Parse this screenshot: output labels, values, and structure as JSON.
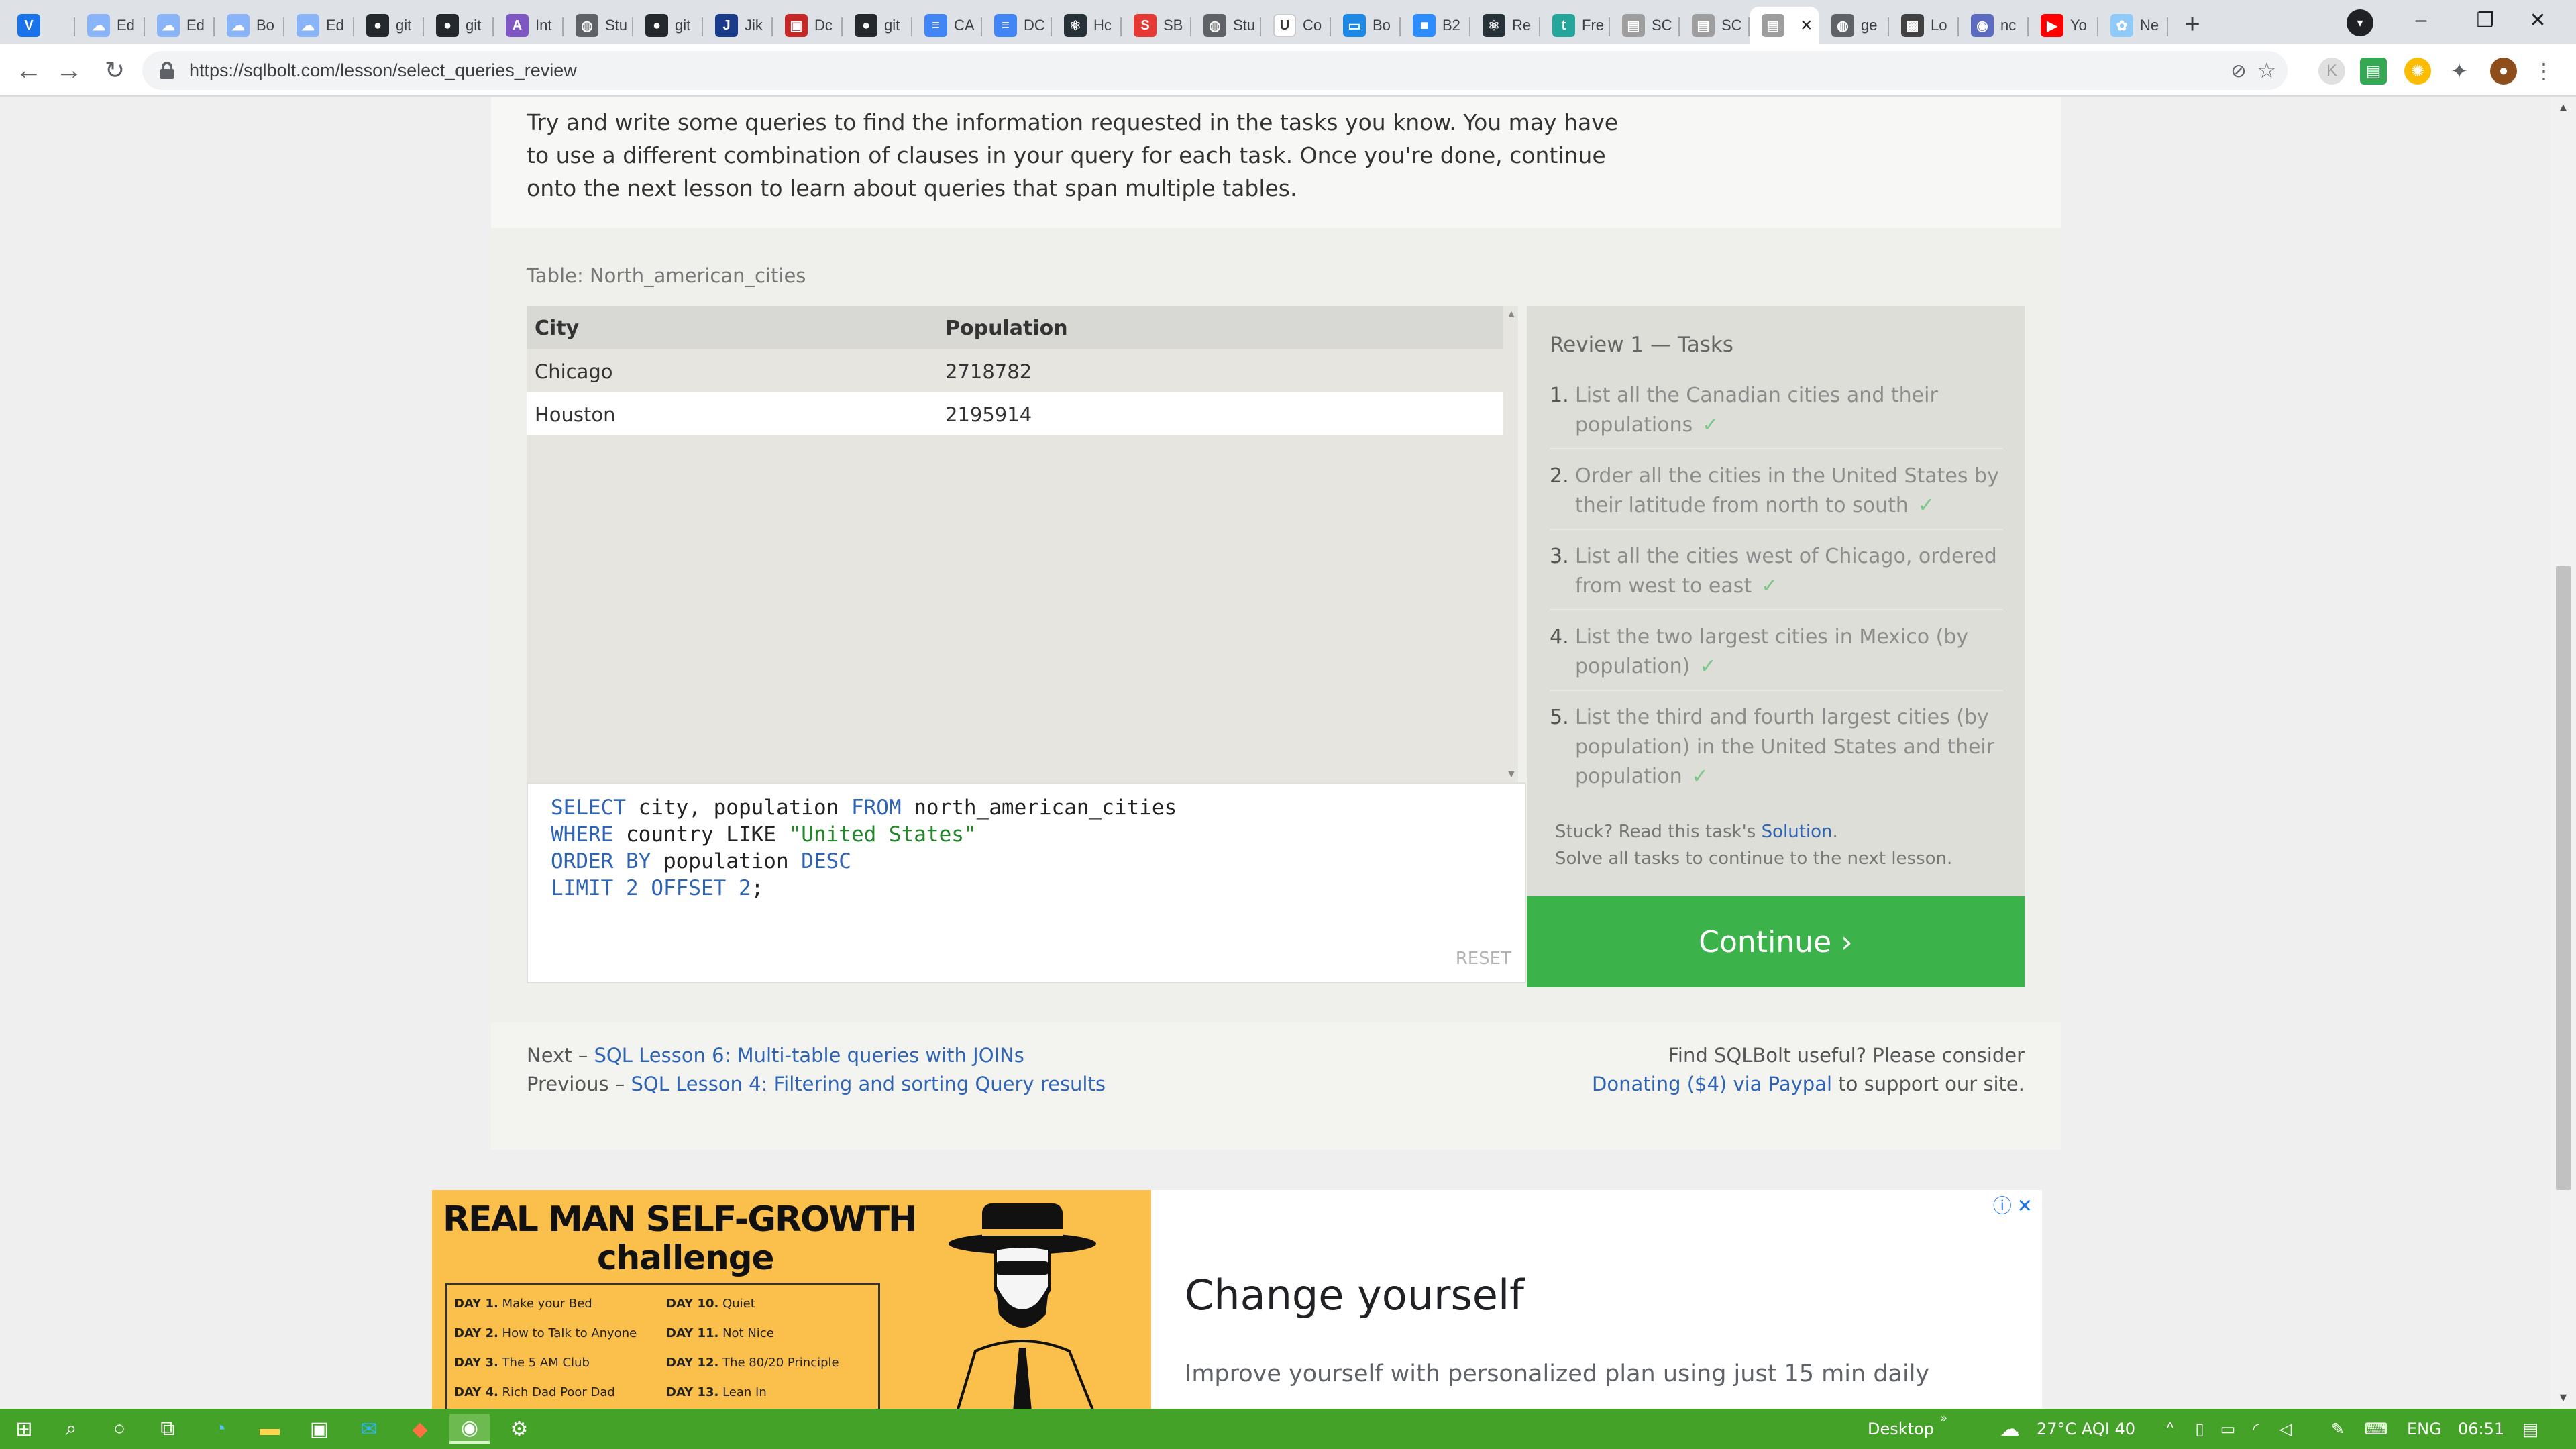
{
  "browser": {
    "tabs": [
      {
        "label": "V",
        "title": "",
        "color": "#1a73e8",
        "glyph": "V"
      },
      {
        "label": "Ed",
        "title": "Ed",
        "color": "#8ab4f8",
        "glyph": "☁"
      },
      {
        "label": "Ed",
        "title": "Ed",
        "color": "#8ab4f8",
        "glyph": "☁"
      },
      {
        "label": "Bo",
        "title": "Bo",
        "color": "#8ab4f8",
        "glyph": "☁"
      },
      {
        "label": "Ed",
        "title": "Ed",
        "color": "#8ab4f8",
        "glyph": "☁"
      },
      {
        "label": "git",
        "title": "git",
        "color": "#24292e",
        "glyph": "●"
      },
      {
        "label": "git",
        "title": "git",
        "color": "#24292e",
        "glyph": "●"
      },
      {
        "label": "Int",
        "title": "Int",
        "color": "#7e57c2",
        "glyph": "A"
      },
      {
        "label": "Stu",
        "title": "Stu",
        "color": "#5f6368",
        "glyph": "◍"
      },
      {
        "label": "git",
        "title": "git",
        "color": "#24292e",
        "glyph": "●"
      },
      {
        "label": "Jik",
        "title": "Jik",
        "color": "#1a3a8a",
        "glyph": "J"
      },
      {
        "label": "Dc",
        "title": "Dc",
        "color": "#c62828",
        "glyph": "▣"
      },
      {
        "label": "git",
        "title": "git",
        "color": "#24292e",
        "glyph": "●"
      },
      {
        "label": "CA",
        "title": "CA",
        "color": "#4285f4",
        "glyph": "≡"
      },
      {
        "label": "DC",
        "title": "DC",
        "color": "#4285f4",
        "glyph": "≡"
      },
      {
        "label": "Hc",
        "title": "Hc",
        "color": "#263238",
        "glyph": "⚛"
      },
      {
        "label": "SB",
        "title": "SB",
        "color": "#e53935",
        "glyph": "S"
      },
      {
        "label": "Stu",
        "title": "Stu",
        "color": "#5f6368",
        "glyph": "◍"
      },
      {
        "label": "Co",
        "title": "Co",
        "color": "#ffffff",
        "glyph": "U"
      },
      {
        "label": "Bo",
        "title": "Bo",
        "color": "#1e88e5",
        "glyph": "▭"
      },
      {
        "label": "B2",
        "title": "B2",
        "color": "#2d8cff",
        "glyph": "■"
      },
      {
        "label": "Re",
        "title": "Re",
        "color": "#263238",
        "glyph": "⚛"
      },
      {
        "label": "Fre",
        "title": "Fre",
        "color": "#26a69a",
        "glyph": "t"
      },
      {
        "label": "SC",
        "title": "SC",
        "color": "#9e9e9e",
        "glyph": "▤"
      },
      {
        "label": "SC",
        "title": "SC",
        "color": "#9e9e9e",
        "glyph": "▤"
      },
      {
        "label": "",
        "title": "",
        "color": "#9e9e9e",
        "glyph": "▤",
        "active": true
      },
      {
        "label": "ge",
        "title": "ge",
        "color": "#5f6368",
        "glyph": "◍"
      },
      {
        "label": "Lo",
        "title": "Lo",
        "color": "#424242",
        "glyph": "▩"
      },
      {
        "label": "nc",
        "title": "nc",
        "color": "#5c6bc0",
        "glyph": "◉"
      },
      {
        "label": "Yo",
        "title": "Yo",
        "color": "#ff0000",
        "glyph": "▶"
      },
      {
        "label": "Ne",
        "title": "Ne",
        "color": "#90caf9",
        "glyph": "✿"
      }
    ],
    "url": "https://sqlbolt.com/lesson/select_queries_review"
  },
  "lesson": {
    "intro": "Try and write some queries to find the information requested in the tasks you know. You may have to use a different combination of clauses in your query for each task. Once you're done, continue onto the next lesson to learn about queries that span multiple tables.",
    "table_caption": "Table: North_american_cities",
    "columns": [
      "City",
      "Population"
    ],
    "rows": [
      [
        "Chicago",
        "2718782"
      ],
      [
        "Houston",
        "2195914"
      ]
    ],
    "query_lines": [
      [
        [
          "kw",
          "SELECT"
        ],
        [
          "t",
          " city, population "
        ],
        [
          "kw",
          "FROM"
        ],
        [
          "t",
          " north_american_cities"
        ]
      ],
      [
        [
          "kw",
          "WHERE"
        ],
        [
          "t",
          " country LIKE "
        ],
        [
          "str",
          "\"United States\""
        ]
      ],
      [
        [
          "kw",
          "ORDER BY"
        ],
        [
          "t",
          " population "
        ],
        [
          "kw",
          "DESC"
        ]
      ],
      [
        [
          "kw",
          "LIMIT"
        ],
        [
          "t",
          " "
        ],
        [
          "num",
          "2"
        ],
        [
          "t",
          " "
        ],
        [
          "kw",
          "OFFSET"
        ],
        [
          "t",
          " "
        ],
        [
          "num",
          "2"
        ],
        [
          "t",
          ";"
        ]
      ]
    ],
    "reset_label": "RESET",
    "tasks_title": "Review 1 — Tasks",
    "tasks": [
      {
        "num": "1.",
        "text": "List all the Canadian cities and their populations",
        "check": "✓"
      },
      {
        "num": "2.",
        "text": "Order all the cities in the United States by their latitude from north to south",
        "check": "✓"
      },
      {
        "num": "3.",
        "text": "List all the cities west of Chicago, ordered from west to east",
        "check": "✓"
      },
      {
        "num": "4.",
        "text": "List the two largest cities in Mexico (by population)",
        "check": "✓"
      },
      {
        "num": "5.",
        "text": "List the third and fourth largest cities (by population) in the United States and their population",
        "check": "✓"
      }
    ],
    "stuck_prefix": "Stuck? Read this task's ",
    "solution_link": "Solution",
    "stuck_suffix": ".",
    "solve_all": "Solve all tasks to continue to the next lesson.",
    "continue_label": "Continue ›",
    "next_prefix": "Next – ",
    "next_link": "SQL Lesson 6: Multi-table queries with JOINs",
    "prev_prefix": "Previous – ",
    "prev_link": "SQL Lesson 4: Filtering and sorting Query results",
    "donate_line1": "Find SQLBolt useful? Please consider",
    "donate_link": "Donating ($4) via Paypal",
    "donate_suffix": " to support our site."
  },
  "ad": {
    "headline1": "REAL MAN SELF-GROWTH",
    "headline2": "challenge",
    "days": [
      {
        "d": "DAY 1.",
        "t": "Make your Bed"
      },
      {
        "d": "DAY 2.",
        "t": "How to Talk to Anyone"
      },
      {
        "d": "DAY 3.",
        "t": "The 5 AM Club"
      },
      {
        "d": "DAY 4.",
        "t": "Rich Dad Poor Dad"
      },
      {
        "d": "DAY 10.",
        "t": "Quiet"
      },
      {
        "d": "DAY 11.",
        "t": "Not Nice"
      },
      {
        "d": "DAY 12.",
        "t": "The 80/20 Principle"
      },
      {
        "d": "DAY 13.",
        "t": "Lean In"
      }
    ],
    "title": "Change yourself",
    "description": "Improve yourself with personalized plan using just 15 min daily"
  },
  "taskbar": {
    "desktop_label": "Desktop",
    "weather": "27°C  AQI 40",
    "language": "ENG",
    "time": "06:51"
  },
  "colors": {
    "continue": "#3bb24a",
    "link": "#2f64b4",
    "taskbar": "#45a229"
  }
}
